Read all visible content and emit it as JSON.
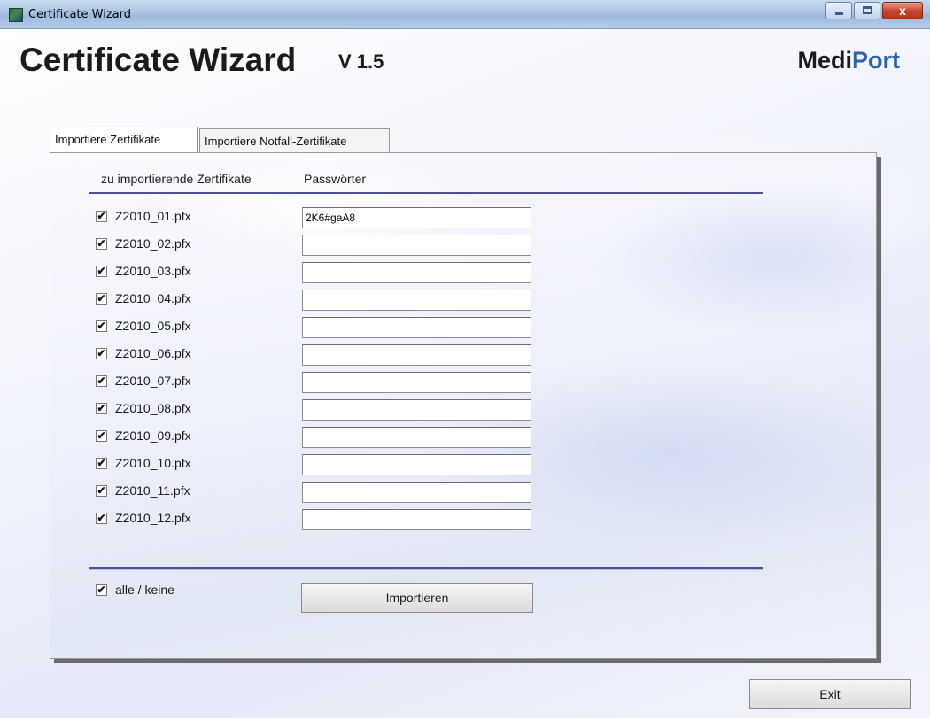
{
  "window": {
    "title": "Certificate Wizard",
    "close_glyph": "x"
  },
  "header": {
    "title": "Certificate Wizard",
    "version": "V 1.5",
    "brand_part1": "Medi",
    "brand_part2": "Port",
    "brand_color": "#2b63b0"
  },
  "tabs": [
    {
      "label": "Importiere  Zertifikate",
      "active": true
    },
    {
      "label": "Importiere Notfall-Zertifikate",
      "active": false
    }
  ],
  "table": {
    "col_certs": "zu importierende Zertifikate",
    "col_passwords": "Passwörter",
    "rows": [
      {
        "file": "Z2010_01.pfx",
        "checked": true,
        "password": "2K6#gaA8"
      },
      {
        "file": "Z2010_02.pfx",
        "checked": true,
        "password": ""
      },
      {
        "file": "Z2010_03.pfx",
        "checked": true,
        "password": ""
      },
      {
        "file": "Z2010_04.pfx",
        "checked": true,
        "password": ""
      },
      {
        "file": "Z2010_05.pfx",
        "checked": true,
        "password": ""
      },
      {
        "file": "Z2010_06.pfx",
        "checked": true,
        "password": ""
      },
      {
        "file": "Z2010_07.pfx",
        "checked": true,
        "password": ""
      },
      {
        "file": "Z2010_08.pfx",
        "checked": true,
        "password": ""
      },
      {
        "file": "Z2010_09.pfx",
        "checked": true,
        "password": ""
      },
      {
        "file": "Z2010_10.pfx",
        "checked": true,
        "password": ""
      },
      {
        "file": "Z2010_11.pfx",
        "checked": true,
        "password": ""
      },
      {
        "file": "Z2010_12.pfx",
        "checked": true,
        "password": ""
      }
    ]
  },
  "select_all": {
    "label": "alle / keine",
    "checked": true
  },
  "buttons": {
    "import": "Importieren",
    "exit": "Exit"
  },
  "check_glyph": "✔"
}
